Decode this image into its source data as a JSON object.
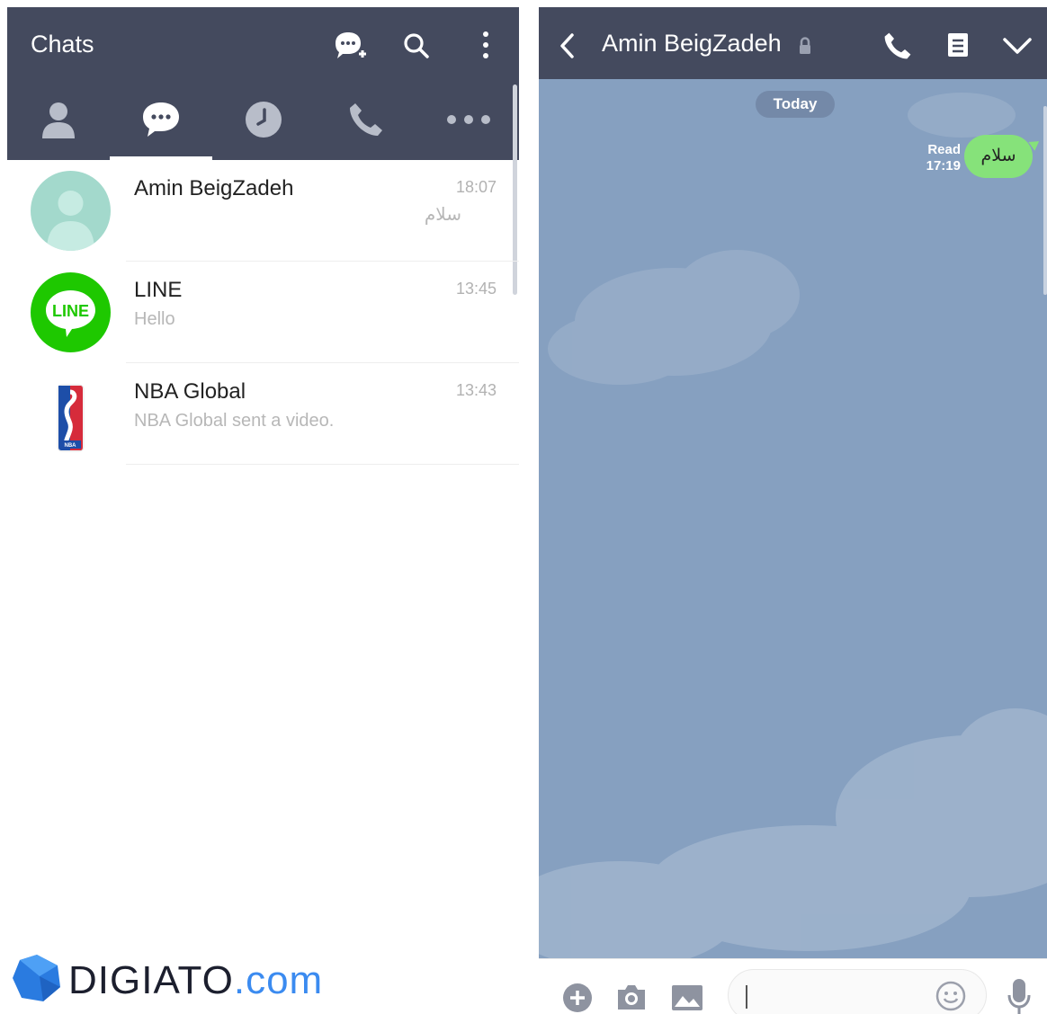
{
  "left_panel": {
    "title": "Chats",
    "header_icons": [
      "add-chat-icon",
      "search-icon",
      "more-vertical-icon"
    ],
    "tabs": [
      {
        "name": "friends",
        "icon": "person-icon",
        "active": false
      },
      {
        "name": "chats",
        "icon": "chat-bubble-icon",
        "active": true
      },
      {
        "name": "timeline",
        "icon": "clock-icon",
        "active": false
      },
      {
        "name": "calls",
        "icon": "phone-icon",
        "active": false
      },
      {
        "name": "more",
        "icon": "more-horizontal-icon",
        "active": false
      }
    ],
    "chats": [
      {
        "name": "Amin BeigZadeh",
        "time": "18:07",
        "preview": "سلام",
        "avatar": "default-avatar"
      },
      {
        "name": "LINE",
        "time": "13:45",
        "preview": "Hello",
        "avatar": "line-logo"
      },
      {
        "name": "NBA Global",
        "time": "13:43",
        "preview": "NBA Global sent a video.",
        "avatar": "nba-logo"
      }
    ]
  },
  "watermark": {
    "brand": "DIGIATO",
    "suffix": ".com"
  },
  "right_panel": {
    "title": "Amin BeigZadeh",
    "header_icons": [
      "back-icon",
      "lock-icon",
      "phone-icon",
      "notes-icon",
      "chevron-down-icon"
    ],
    "date_label": "Today",
    "messages": [
      {
        "text": "سلام",
        "status": "Read",
        "time": "17:19",
        "outgoing": true
      }
    ],
    "input": {
      "value": "",
      "icons": [
        "plus-icon",
        "camera-icon",
        "image-icon",
        "emoji-icon",
        "microphone-icon"
      ]
    }
  },
  "colors": {
    "header": "#444a5e",
    "room_background": "#86a0c0",
    "bubble_outgoing": "#86e27a",
    "line_green": "#1ec800",
    "avatar_default": "#a3d9cc",
    "watermark_blue": "#3b8bf0"
  }
}
